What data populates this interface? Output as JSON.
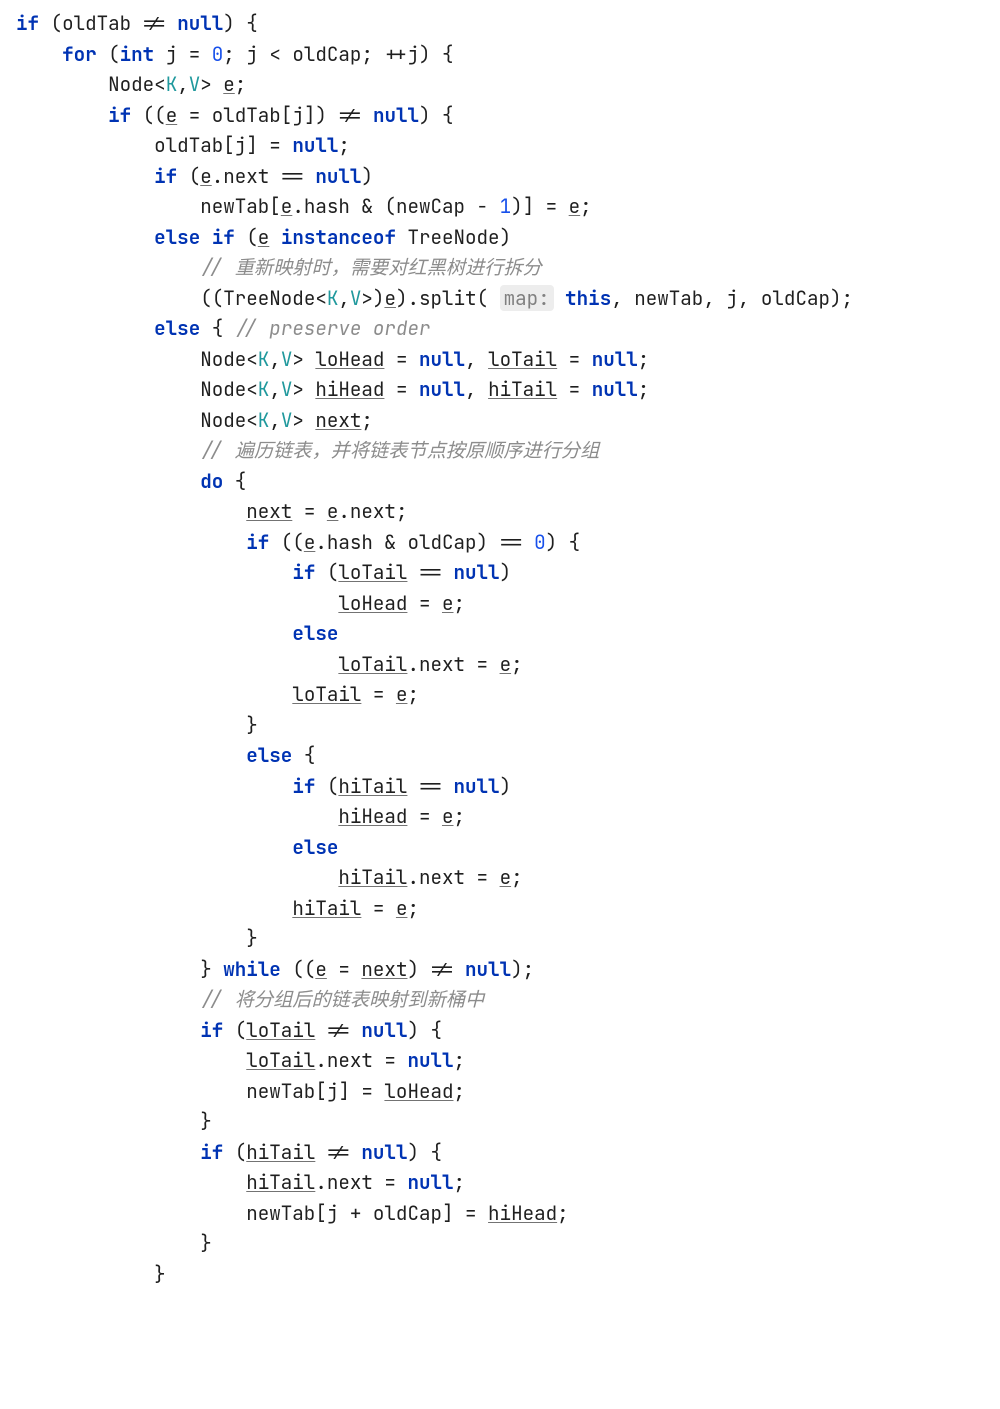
{
  "code": {
    "c0": "// 重新映射时，需要对红黑树进行拆分",
    "c1": "// preserve order",
    "c2": "// 遍历链表，并将链表节点按原顺序进行分组",
    "c3": "// 将分组后的链表映射到新桶中",
    "hint_map": "map:",
    "oldTab": "oldTab",
    "newTab": "newTab",
    "oldCap": "oldCap",
    "newCap": "newCap",
    "e": "e",
    "j": "j",
    "next": "next",
    "hash": "hash",
    "loHead": "loHead",
    "loTail": "loTail",
    "hiHead": "hiHead",
    "hiTail": "hiTail",
    "Node": "Node",
    "TreeNode": "TreeNode",
    "K": "K",
    "V": "V",
    "split": "split",
    "null": "null",
    "if": "if",
    "for": "for",
    "int": "int",
    "else": "else",
    "do": "do",
    "while": "while",
    "instanceof": "instanceof",
    "this": "this",
    "zero": "0",
    "one": "1"
  }
}
